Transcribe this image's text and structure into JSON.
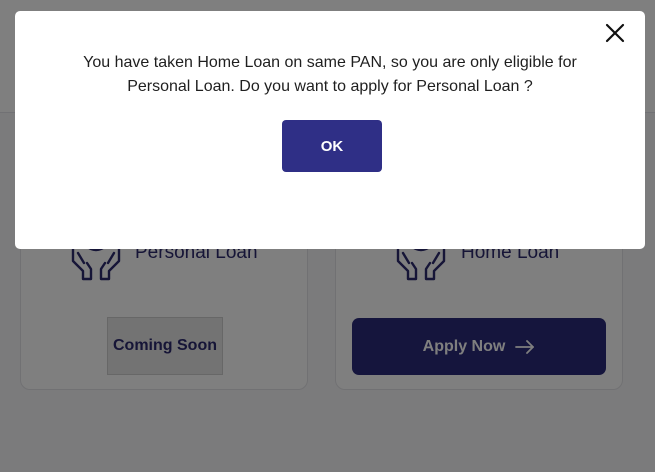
{
  "modal": {
    "message": "You have taken Home Loan on same PAN, so you are only eligible for Personal Loan. Do you want to apply for Personal Loan ?",
    "ok_label": "OK",
    "close_icon": "close-icon"
  },
  "cards": {
    "personal": {
      "title": "Personal Loan",
      "icon": "hands-heart-icon",
      "button_label": "Coming Soon"
    },
    "home": {
      "title": "Home Loan",
      "icon": "hands-heart-icon",
      "button_label": "Apply Now",
      "button_icon": "arrow-right-icon"
    }
  },
  "colors": {
    "brand": "#2b2a7a",
    "title": "#2d2a6e",
    "overlay": "rgba(0,0,0,0.5)"
  }
}
